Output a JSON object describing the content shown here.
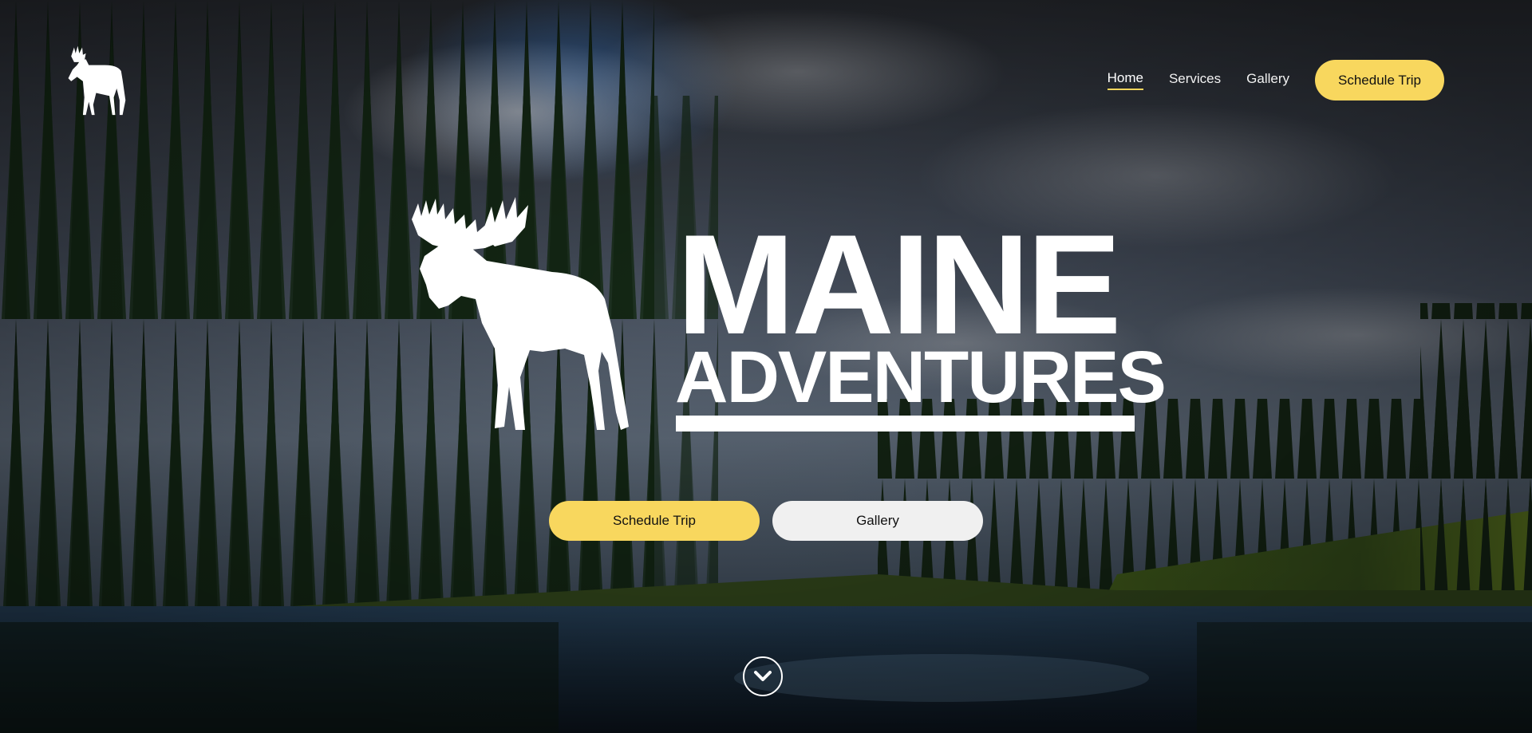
{
  "nav": {
    "links": [
      {
        "label": "Home",
        "active": true
      },
      {
        "label": "Services",
        "active": false
      },
      {
        "label": "Gallery",
        "active": false
      }
    ],
    "cta_label": "Schedule Trip"
  },
  "hero": {
    "title_main": "MAINE",
    "title_sub": "ADVENTURES",
    "primary_cta": "Schedule Trip",
    "secondary_cta": "Gallery"
  },
  "icons": {
    "logo": "moose-logo-icon",
    "hero": "moose-silhouette-icon",
    "scroll": "chevron-down-icon"
  },
  "colors": {
    "accent": "#f8d75e",
    "light_button": "#f0f0f0",
    "text": "#ffffff"
  }
}
